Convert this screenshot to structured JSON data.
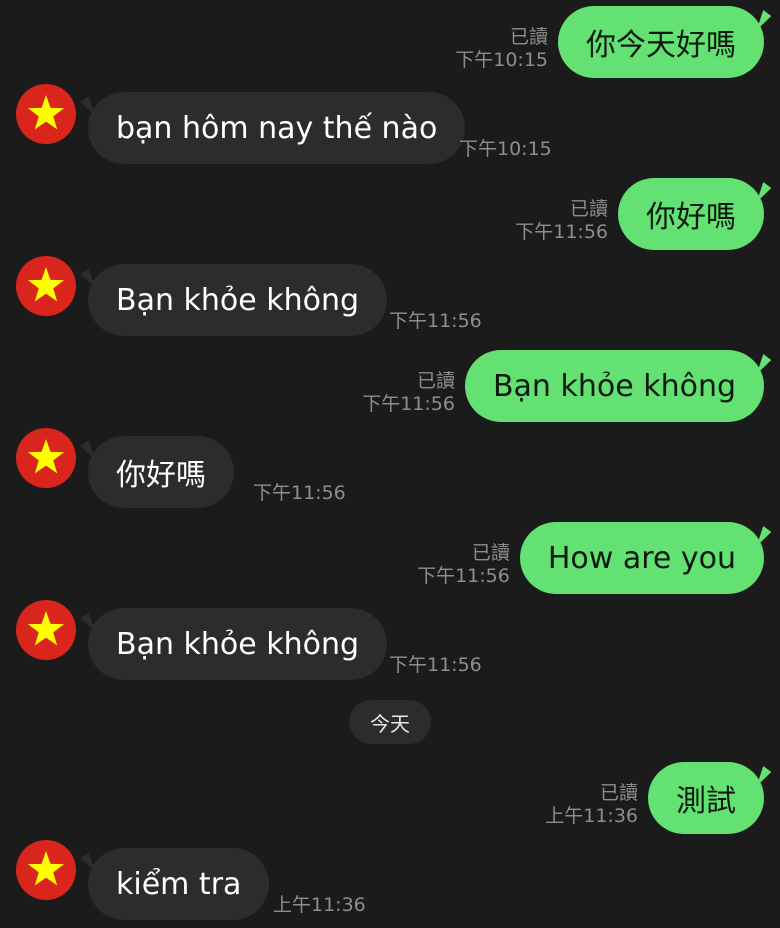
{
  "messages": [
    {
      "side": "out",
      "text": "你今天好嗎",
      "read": "已讀",
      "time": "下午10:15"
    },
    {
      "side": "in",
      "text": "bạn hôm nay thế nào",
      "time": "下午10:15"
    },
    {
      "side": "out",
      "text": "你好嗎",
      "read": "已讀",
      "time": "下午11:56"
    },
    {
      "side": "in",
      "text": "Bạn khỏe không",
      "time": "下午11:56"
    },
    {
      "side": "out",
      "text": "Bạn khỏe không",
      "read": "已讀",
      "time": "下午11:56"
    },
    {
      "side": "in",
      "text": "你好嗎",
      "time": "下午11:56"
    },
    {
      "side": "out",
      "text": "How are you",
      "read": "已讀",
      "time": "下午11:56"
    },
    {
      "side": "in",
      "text": "Bạn khỏe không",
      "time": "下午11:56"
    },
    {
      "side": "out",
      "text": "測試",
      "read": "已讀",
      "time": "上午11:36"
    },
    {
      "side": "in",
      "text": "kiểm tra",
      "time": "上午11:36"
    }
  ],
  "date_separator": "今天",
  "contact_avatar": {
    "icon": "vietnam-flag-icon",
    "background": "#da251d",
    "star": "#ffff00"
  },
  "colors": {
    "background": "#1b1b1b",
    "outgoing_bubble": "#63e172",
    "incoming_bubble": "#2c2c2d",
    "meta_text": "#8e8e8e"
  }
}
